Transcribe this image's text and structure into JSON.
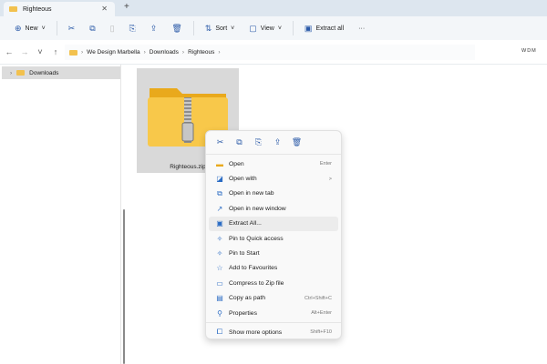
{
  "tab": {
    "title": "Righteous",
    "close": "✕",
    "new_tab": "+"
  },
  "toolbar": {
    "new": "New",
    "sort": "Sort",
    "view": "View",
    "extract_all": "Extract all",
    "more": "···"
  },
  "address": {
    "crumbs": [
      "We Design Marbella",
      "Downloads",
      "Righteous"
    ],
    "search_hint": "WDM"
  },
  "sidebar": {
    "items": [
      {
        "label": "Downloads"
      }
    ]
  },
  "file": {
    "name": "Righteous.zip"
  },
  "context_menu": {
    "items": [
      {
        "label": "Open",
        "shortcut": "Enter",
        "icon": "folder-icon"
      },
      {
        "label": "Open with",
        "shortcut": ">",
        "icon": "open-with-icon"
      },
      {
        "label": "Open in new tab",
        "shortcut": "",
        "icon": "new-tab-icon"
      },
      {
        "label": "Open in new window",
        "shortcut": "",
        "icon": "new-window-icon"
      },
      {
        "label": "Extract All...",
        "shortcut": "",
        "icon": "extract-icon"
      },
      {
        "label": "Pin to Quick access",
        "shortcut": "",
        "icon": "pin-icon"
      },
      {
        "label": "Pin to Start",
        "shortcut": "",
        "icon": "pin-icon"
      },
      {
        "label": "Add to Favourites",
        "shortcut": "",
        "icon": "star-icon"
      },
      {
        "label": "Compress to Zip file",
        "shortcut": "",
        "icon": "zip-icon"
      },
      {
        "label": "Copy as path",
        "shortcut": "Ctrl+Shift+C",
        "icon": "copy-path-icon"
      },
      {
        "label": "Properties",
        "shortcut": "Alt+Enter",
        "icon": "wrench-icon"
      }
    ],
    "more": {
      "label": "Show more options",
      "shortcut": "Shift+F10"
    }
  }
}
